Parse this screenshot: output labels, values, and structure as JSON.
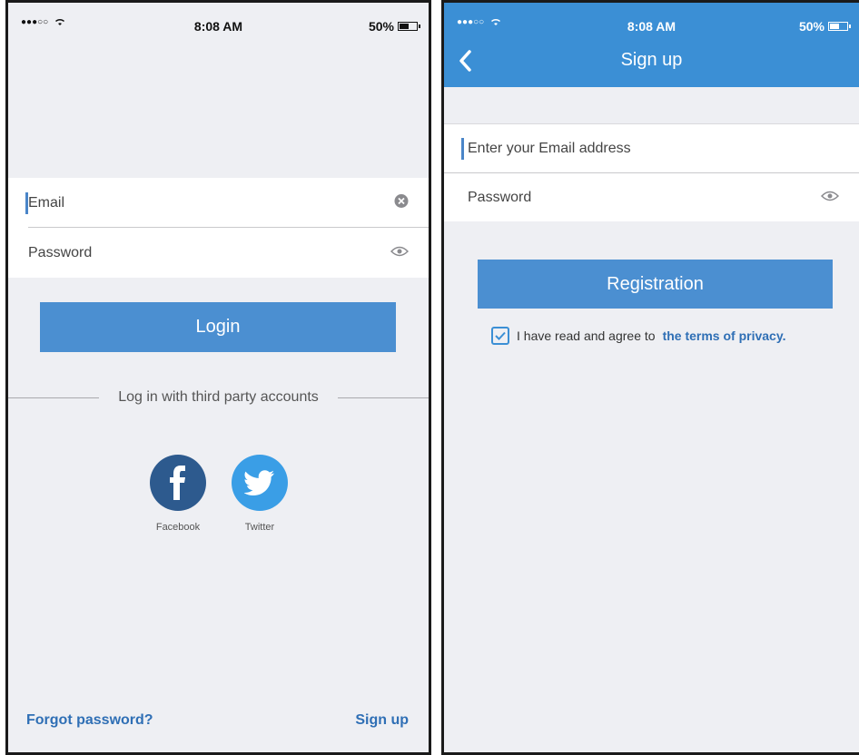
{
  "status_bar": {
    "signal": "●●●○○",
    "time": "8:08 AM",
    "battery": "50%"
  },
  "login": {
    "email_placeholder": "Email",
    "password_placeholder": "Password",
    "login_button": "Login",
    "third_party_label": "Log in with third party accounts",
    "social": [
      {
        "label": "Facebook",
        "icon": "facebook-icon",
        "color": "#2d5a8e"
      },
      {
        "label": "Twitter",
        "icon": "twitter-icon",
        "color": "#3a9ee6"
      }
    ],
    "forgot_password": "Forgot password?",
    "sign_up": "Sign up"
  },
  "signup": {
    "title": "Sign up",
    "email_placeholder": "Enter your Email address",
    "password_placeholder": "Password",
    "registration_button": "Registration",
    "terms_text": "I have read and agree to",
    "terms_link": "the terms of privacy.",
    "terms_checked": true
  },
  "colors": {
    "accent": "#4b8fd1",
    "nav_bar": "#3b8fd5",
    "link": "#2f6fb5",
    "background": "#eeeff3"
  }
}
